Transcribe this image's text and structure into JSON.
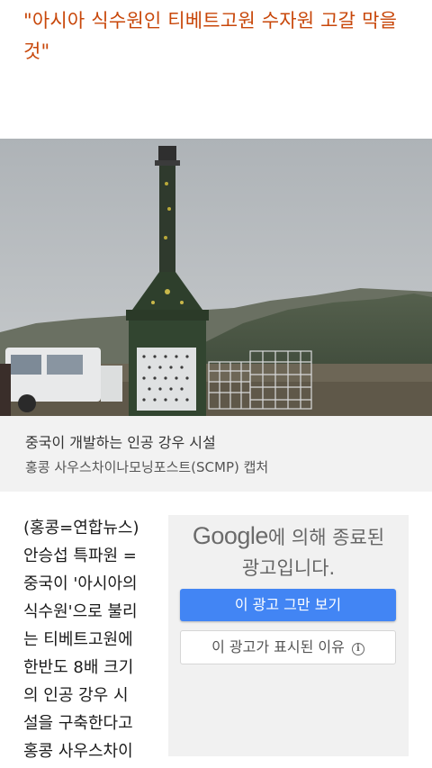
{
  "article": {
    "headline_line1": "\"아시아 식수원인 티베트고원 수자원 고갈 막을",
    "headline_line2": "것\""
  },
  "photo": {
    "alt": "중국이 개발하는 인공 강우 시설"
  },
  "caption": {
    "title": "중국이 개발하는 인공 강우 시설",
    "credit": "홍콩 사우스차이나모닝포스트(SCMP) 캡처"
  },
  "body": {
    "lines": [
      "(홍콩=연합뉴스)",
      "안승섭 특파원 =",
      "중국이 '아시아의",
      "식수원'으로 불리",
      "는 티베트고원에",
      "한반도 8배 크기",
      "의 인공 강우 시",
      "설을 구축한다고",
      "홍콩 사우스차이"
    ]
  },
  "ad": {
    "brand": "Google",
    "message_rest": "에 의해 종료된",
    "message_line2": "광고입니다.",
    "stop_button": "이 광고 그만 보기",
    "why_button": "이 광고가 표시된 이유",
    "info_icon": "ⓘ"
  },
  "colors": {
    "headline": "#c8470a",
    "ad_primary": "#4285f4"
  }
}
